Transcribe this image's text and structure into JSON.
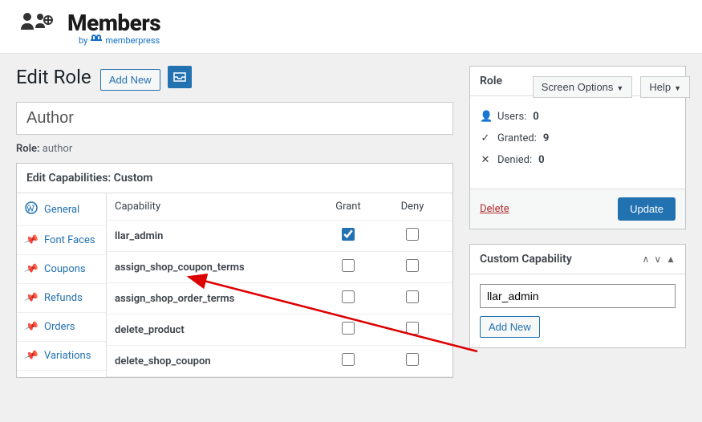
{
  "logo": {
    "brand": "Members",
    "by_prefix": "by",
    "by_name": "memberpress"
  },
  "top_panels": {
    "screen_options": "Screen Options",
    "help": "Help"
  },
  "header": {
    "title": "Edit Role",
    "add_new": "Add New"
  },
  "role_input": {
    "value": "Author"
  },
  "role_meta": {
    "label": "Role:",
    "slug": "author"
  },
  "capbox": {
    "title": "Edit Capabilities: Custom",
    "tabs": [
      "General",
      "Font Faces",
      "Coupons",
      "Refunds",
      "Orders",
      "Variations"
    ],
    "columns": {
      "name": "Capability",
      "grant": "Grant",
      "deny": "Deny"
    },
    "rows": [
      {
        "name": "llar_admin",
        "grant": true,
        "deny": false
      },
      {
        "name": "assign_shop_coupon_terms",
        "grant": false,
        "deny": false
      },
      {
        "name": "assign_shop_order_terms",
        "grant": false,
        "deny": false
      },
      {
        "name": "delete_product",
        "grant": false,
        "deny": false
      },
      {
        "name": "delete_shop_coupon",
        "grant": false,
        "deny": false
      }
    ]
  },
  "rolebox": {
    "title": "Role",
    "users_label": "Users:",
    "users": "0",
    "granted_label": "Granted:",
    "granted": "9",
    "denied_label": "Denied:",
    "denied": "0",
    "delete": "Delete",
    "update": "Update"
  },
  "custombox": {
    "title": "Custom Capability",
    "input_value": "llar_admin",
    "add_new": "Add New"
  },
  "colors": {
    "accent": "#2271b1",
    "danger": "#b32d2e"
  }
}
